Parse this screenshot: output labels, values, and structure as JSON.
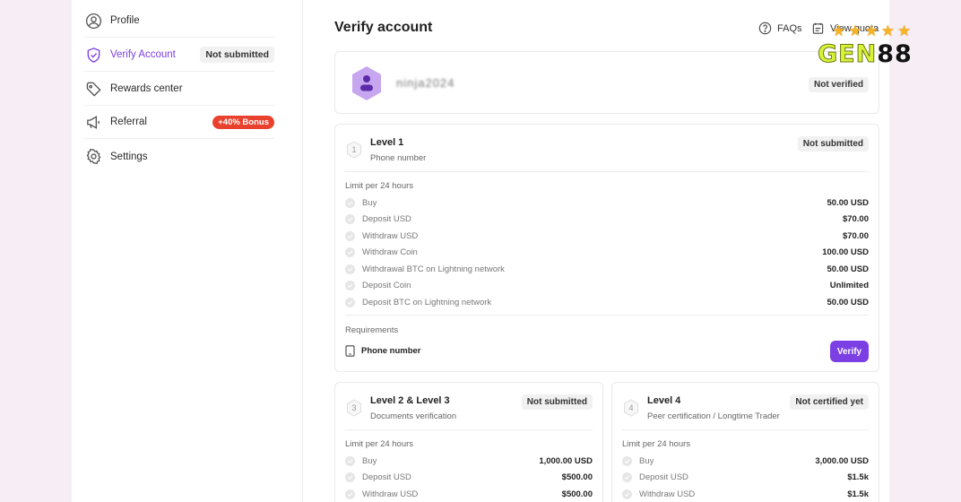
{
  "sidebar": {
    "items": [
      {
        "label": "Profile",
        "icon": "user-circle-icon"
      },
      {
        "label": "Verify Account",
        "icon": "shield-check-icon",
        "badge": "Not submitted",
        "active": true
      },
      {
        "label": "Rewards center",
        "icon": "tag-icon"
      },
      {
        "label": "Referral",
        "icon": "megaphone-icon",
        "badge": "+40% Bonus"
      },
      {
        "label": "Settings",
        "icon": "gear-icon"
      }
    ]
  },
  "header": {
    "title": "Verify account",
    "faqs": "FAQs",
    "view_quota": "View quota"
  },
  "account": {
    "username": "ninja2024",
    "status": "Not verified"
  },
  "level1": {
    "number": "1",
    "title": "Level 1",
    "subtitle": "Phone number",
    "status": "Not submitted",
    "limit_label": "Limit per 24 hours",
    "rows": [
      {
        "label": "Buy",
        "value": "50.00 USD"
      },
      {
        "label": "Deposit USD",
        "value": "$70.00"
      },
      {
        "label": "Withdraw USD",
        "value": "$70.00"
      },
      {
        "label": "Withdraw Coin",
        "value": "100.00 USD"
      },
      {
        "label": "Withdrawal BTC on Lightning network",
        "value": "50.00 USD"
      },
      {
        "label": "Deposit Coin",
        "value": "Unlimited"
      },
      {
        "label": "Deposit BTC on Lightning network",
        "value": "50.00 USD"
      }
    ],
    "requirements_label": "Requirements",
    "requirement": "Phone number",
    "verify_label": "Verify"
  },
  "level23": {
    "number": "3",
    "title": "Level 2 & Level 3",
    "subtitle": "Documents verification",
    "status": "Not submitted",
    "limit_label": "Limit per 24 hours",
    "rows": [
      {
        "label": "Buy",
        "value": "1,000.00 USD"
      },
      {
        "label": "Deposit USD",
        "value": "$500.00"
      },
      {
        "label": "Withdraw USD",
        "value": "$500.00"
      }
    ]
  },
  "level4": {
    "number": "4",
    "title": "Level 4",
    "subtitle": "Peer certification / Longtime Trader",
    "status": "Not certified yet",
    "limit_label": "Limit per 24 hours",
    "rows": [
      {
        "label": "Buy",
        "value": "3,000.00 USD"
      },
      {
        "label": "Deposit USD",
        "value": "$1.5k"
      },
      {
        "label": "Withdraw USD",
        "value": "$1.5k"
      }
    ]
  },
  "brand": {
    "prefix": "GEN",
    "suffix": "88",
    "stars": "★★★★★"
  },
  "colors": {
    "accent": "#7b3fe4",
    "bonus": "#e8412e",
    "background": "#f7eef5"
  }
}
